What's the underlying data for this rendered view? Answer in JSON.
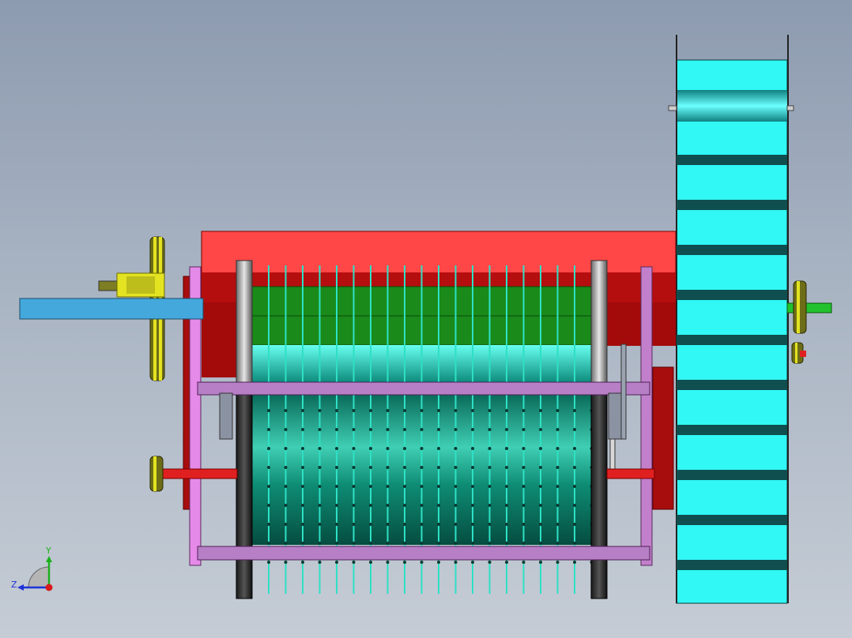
{
  "viewport": {
    "background_top": "#8d9bb0",
    "background_bottom": "#c5ccd5"
  },
  "colors": {
    "hopper_red": "#ff4747",
    "frame_dark_red": "#a80d0d",
    "frame_purple": "#c98ed0",
    "drum_teal": "#0f8a72",
    "roller_green": "#1a8a1a",
    "wheel_cyan": "#31f7f5",
    "wheel_band": "#0f4f4f",
    "shaft_blue": "#44a8dc",
    "pulley_yellow": "#e3e322",
    "shaft_green": "#22c22e"
  },
  "triad": {
    "x_axis_icon": "x-axis-arrow-icon",
    "y_label": "Y",
    "z_label": "Z",
    "y_color": "#1cb01c",
    "z_color": "#1e32d8",
    "x_color": "#d81c1c"
  }
}
